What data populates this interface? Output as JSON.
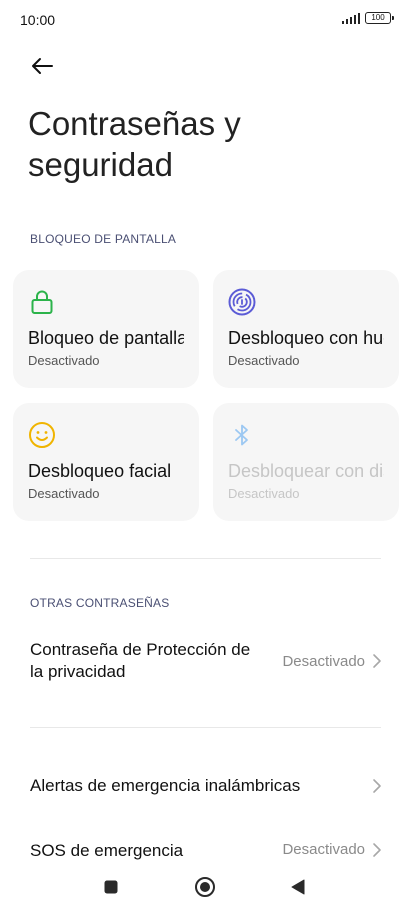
{
  "status_bar": {
    "time": "10:00",
    "battery": "100"
  },
  "page": {
    "title": "Contraseñas y seguridad"
  },
  "sections": {
    "screen_lock": "BLOQUEO DE PANTALLA",
    "other_passwords": "OTRAS CONTRASEÑAS"
  },
  "cards": [
    {
      "title": "Bloqueo de pantalla",
      "status": "Desactivado",
      "icon": "lock-icon",
      "color": "#2bb34a",
      "enabled": true
    },
    {
      "title": "Desbloqueo con huella",
      "status": "Desactivado",
      "icon": "fingerprint-icon",
      "color": "#5b5bd6",
      "enabled": true
    },
    {
      "title": "Desbloqueo facial",
      "status": "Desactivado",
      "icon": "face-icon",
      "color": "#f0b400",
      "enabled": true
    },
    {
      "title": "Desbloquear con dispositivo Bluetooth",
      "status": "Desactivado",
      "icon": "bluetooth-icon",
      "color": "#9cc8f2",
      "enabled": false
    }
  ],
  "rows": [
    {
      "title": "Contraseña de Protección de la privacidad",
      "value": "Desactivado"
    },
    {
      "title": "Alertas de emergencia inalámbricas",
      "value": ""
    },
    {
      "title": "SOS de emergencia",
      "value": "Desactivado"
    }
  ]
}
